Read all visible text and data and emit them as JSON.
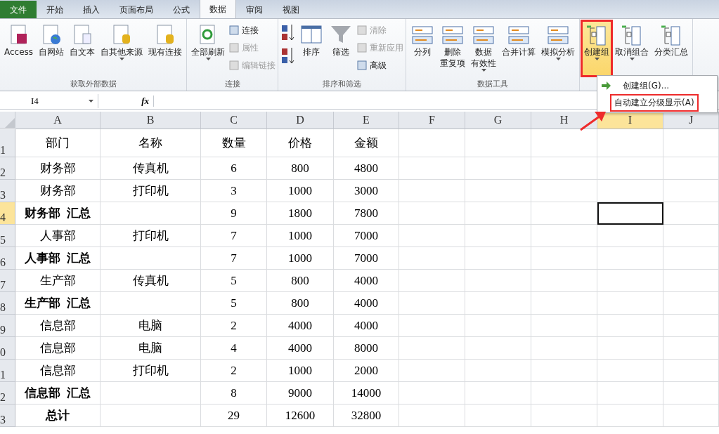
{
  "tabs": [
    {
      "label": "文件",
      "kind": "file",
      "selected": false
    },
    {
      "label": "开始",
      "kind": "tab",
      "selected": false
    },
    {
      "label": "插入",
      "kind": "tab",
      "selected": false
    },
    {
      "label": "页面布局",
      "kind": "tab",
      "selected": false
    },
    {
      "label": "公式",
      "kind": "tab",
      "selected": false
    },
    {
      "label": "数据",
      "kind": "tab",
      "selected": true
    },
    {
      "label": "审阅",
      "kind": "tab",
      "selected": false
    },
    {
      "label": "视图",
      "kind": "tab",
      "selected": false
    }
  ],
  "groups": [
    {
      "label": "获取外部数据",
      "buttons": [
        {
          "kind": "large",
          "lines": [
            "Access"
          ],
          "dropdown": false,
          "highlighted": false
        },
        {
          "kind": "large",
          "lines": [
            "自网站"
          ],
          "dropdown": false,
          "highlighted": false
        },
        {
          "kind": "large",
          "lines": [
            "自文本"
          ],
          "dropdown": false,
          "highlighted": false
        },
        {
          "kind": "large",
          "lines": [
            "自其他来源"
          ],
          "dropdown": true,
          "highlighted": false
        },
        {
          "kind": "large",
          "lines": [
            "现有连接"
          ],
          "dropdown": false,
          "highlighted": false
        }
      ]
    },
    {
      "label": "连接",
      "buttons": [
        {
          "kind": "large",
          "lines": [
            "全部刷新"
          ],
          "dropdown": true,
          "highlighted": false
        },
        {
          "kind": "small",
          "lines": [
            "连接"
          ],
          "disabled": false
        },
        {
          "kind": "small",
          "lines": [
            "属性"
          ],
          "disabled": true
        },
        {
          "kind": "small",
          "lines": [
            "编辑链接"
          ],
          "disabled": true
        }
      ]
    },
    {
      "label": "排序和筛选",
      "buttons": [
        {
          "kind": "sortpair"
        },
        {
          "kind": "large",
          "lines": [
            "排序"
          ],
          "dropdown": false,
          "highlighted": false
        },
        {
          "kind": "large",
          "lines": [
            "筛选"
          ],
          "dropdown": false,
          "highlighted": false
        },
        {
          "kind": "small",
          "lines": [
            "清除"
          ],
          "disabled": true
        },
        {
          "kind": "small",
          "lines": [
            "重新应用"
          ],
          "disabled": true
        },
        {
          "kind": "small",
          "lines": [
            "高级"
          ],
          "disabled": false
        }
      ]
    },
    {
      "label": "数据工具",
      "buttons": [
        {
          "kind": "large",
          "lines": [
            "分列"
          ],
          "dropdown": false,
          "highlighted": false
        },
        {
          "kind": "large",
          "lines": [
            "删除",
            "重复项"
          ],
          "dropdown": false,
          "highlighted": false
        },
        {
          "kind": "large",
          "lines": [
            "数据",
            "有效性"
          ],
          "dropdown": true,
          "highlighted": false
        },
        {
          "kind": "large",
          "lines": [
            "合并计算"
          ],
          "dropdown": false,
          "highlighted": false
        },
        {
          "kind": "large",
          "lines": [
            "模拟分析"
          ],
          "dropdown": true,
          "highlighted": false
        }
      ]
    },
    {
      "buttons": [
        {
          "kind": "large",
          "lines": [
            "创建组"
          ],
          "dropdown": true,
          "highlighted": true
        },
        {
          "kind": "large",
          "lines": [
            "取消组合"
          ],
          "dropdown": true,
          "highlighted": false
        },
        {
          "kind": "large",
          "lines": [
            "分类汇总"
          ],
          "dropdown": false,
          "highlighted": false
        }
      ]
    }
  ],
  "menu": {
    "items": [
      {
        "label": "创建组(G)...",
        "kind": "with-icon",
        "annotated": false
      },
      {
        "label": "自动建立分级显示(A)",
        "kind": "plain",
        "annotated": true
      }
    ]
  },
  "formula_bar": {
    "name_box": "I4",
    "fx": "fx"
  },
  "sheet": {
    "columns": [
      {
        "label": "A",
        "selected": false
      },
      {
        "label": "B",
        "selected": false
      },
      {
        "label": "C",
        "selected": false
      },
      {
        "label": "D",
        "selected": false
      },
      {
        "label": "E",
        "selected": false
      },
      {
        "label": "F",
        "selected": false
      },
      {
        "label": "G",
        "selected": false
      },
      {
        "label": "H",
        "selected": false
      },
      {
        "label": "I",
        "selected": true
      },
      {
        "label": "J",
        "selected": false
      }
    ],
    "rows": [
      {
        "number": "1",
        "bold": false,
        "selected": false,
        "cells": [
          "部门",
          "名称",
          "数量",
          "价格",
          "金额"
        ]
      },
      {
        "number": "2",
        "bold": false,
        "selected": false,
        "cells": [
          "财务部",
          "传真机",
          "6",
          "800",
          "4800"
        ]
      },
      {
        "number": "3",
        "bold": false,
        "selected": false,
        "cells": [
          "财务部",
          "打印机",
          "3",
          "1000",
          "3000"
        ]
      },
      {
        "number": "4",
        "bold": true,
        "selected": true,
        "cells": [
          "财务部  汇总",
          "",
          "9",
          "1800",
          "7800"
        ]
      },
      {
        "number": "5",
        "bold": false,
        "selected": false,
        "cells": [
          "人事部",
          "打印机",
          "7",
          "1000",
          "7000"
        ]
      },
      {
        "number": "6",
        "bold": true,
        "selected": false,
        "cells": [
          "人事部  汇总",
          "",
          "7",
          "1000",
          "7000"
        ]
      },
      {
        "number": "7",
        "bold": false,
        "selected": false,
        "cells": [
          "生产部",
          "传真机",
          "5",
          "800",
          "4000"
        ]
      },
      {
        "number": "8",
        "bold": true,
        "selected": false,
        "cells": [
          "生产部  汇总",
          "",
          "5",
          "800",
          "4000"
        ]
      },
      {
        "number": "9",
        "bold": false,
        "selected": false,
        "cells": [
          "信息部",
          "电脑",
          "2",
          "4000",
          "4000"
        ]
      },
      {
        "number": "0",
        "bold": false,
        "selected": false,
        "cells": [
          "信息部",
          "电脑",
          "4",
          "4000",
          "8000"
        ]
      },
      {
        "number": "1",
        "bold": false,
        "selected": false,
        "cells": [
          "信息部",
          "打印机",
          "2",
          "1000",
          "2000"
        ]
      },
      {
        "number": "2",
        "bold": true,
        "selected": false,
        "cells": [
          "信息部  汇总",
          "",
          "8",
          "9000",
          "14000"
        ]
      },
      {
        "number": "3",
        "bold": true,
        "selected": false,
        "cells": [
          "总计",
          "",
          "29",
          "12600",
          "32800"
        ]
      }
    ]
  }
}
